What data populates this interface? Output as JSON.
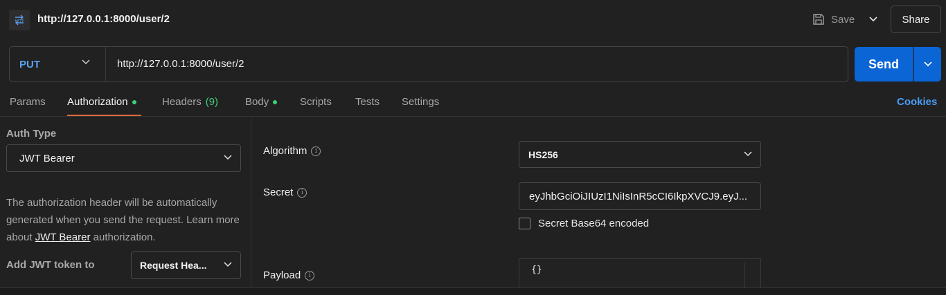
{
  "header": {
    "icon": "http-icon",
    "title": "http://127.0.0.1:8000/user/2",
    "save_label": "Save",
    "share_label": "Share"
  },
  "request": {
    "method": "PUT",
    "url": "http://127.0.0.1:8000/user/2",
    "send_label": "Send"
  },
  "tabs": [
    {
      "label": "Params"
    },
    {
      "label": "Authorization",
      "active": true,
      "dot": true
    },
    {
      "label": "Headers",
      "count": "(9)"
    },
    {
      "label": "Body",
      "dot": true
    },
    {
      "label": "Scripts"
    },
    {
      "label": "Tests"
    },
    {
      "label": "Settings"
    }
  ],
  "cookies_label": "Cookies",
  "auth": {
    "type_label": "Auth Type",
    "type_value": "JWT Bearer",
    "desc_before": "The authorization header will be automatically generated when you send the request. Learn more about ",
    "desc_link": "JWT Bearer",
    "desc_after": " authorization.",
    "add_token_label": "Add JWT token to",
    "add_token_value": "Request Hea..."
  },
  "jwt": {
    "algorithm_label": "Algorithm",
    "algorithm_value": "HS256",
    "secret_label": "Secret",
    "secret_value": "eyJhbGciOiJIUzI1NiIsInR5cCI6IkpXVCJ9.eyJ...",
    "base64_label": "Secret Base64 encoded",
    "base64_checked": false,
    "payload_label": "Payload",
    "payload_value": "{}"
  },
  "colors": {
    "accent": "#0b65d4",
    "method": "#5aa0f0",
    "active_tab_underline": "#e06a3a",
    "status_dot": "#3ecf7a",
    "cookies": "#4a9cf5"
  }
}
